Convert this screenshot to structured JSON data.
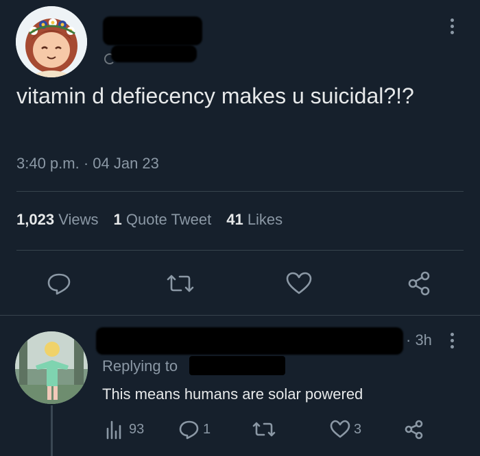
{
  "tweet": {
    "text": "vitamin d defiecency makes u suicidal?!?",
    "time": "3:40 p.m. · 04 Jan 23",
    "stats": {
      "views_count": "1,023",
      "views_label": "Views",
      "quotes_count": "1",
      "quotes_label": "Quote Tweet",
      "likes_count": "41",
      "likes_label": "Likes"
    },
    "actions": [
      "reply-icon",
      "retweet-icon",
      "like-icon",
      "share-icon"
    ]
  },
  "reply": {
    "time": "· 3h",
    "replying_to": "Replying to",
    "text": "This means humans are solar powered",
    "views": "93",
    "replies": "1",
    "likes": "3",
    "actions": [
      "views-icon",
      "reply-icon",
      "retweet-icon",
      "like-icon",
      "share-icon"
    ]
  },
  "colors": {
    "background": "#16202c",
    "text": "#e7e9ea",
    "secondary": "#8b98a5",
    "divider": "#38444d"
  }
}
